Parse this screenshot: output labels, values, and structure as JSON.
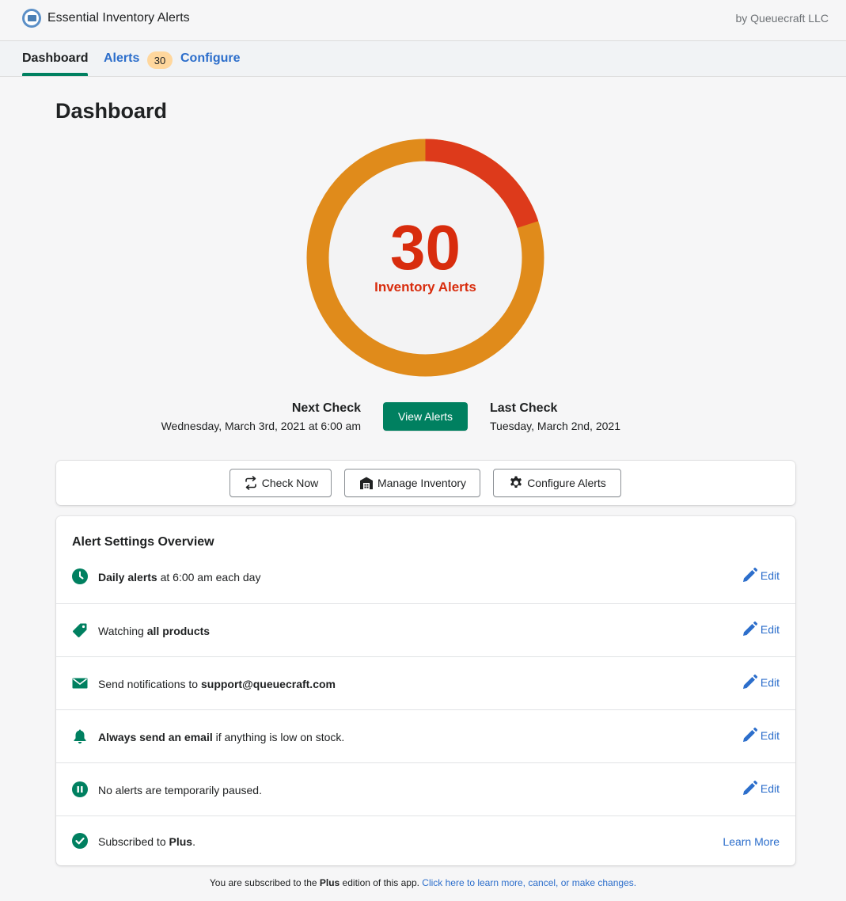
{
  "app": {
    "title": "Essential Inventory Alerts",
    "vendor": "by Queuecraft LLC"
  },
  "tabs": {
    "dashboard": "Dashboard",
    "alerts": "Alerts",
    "alerts_count": "30",
    "configure": "Configure"
  },
  "page": {
    "title": "Dashboard"
  },
  "summary": {
    "count": "30",
    "label": "Inventory Alerts",
    "next_check_heading": "Next Check",
    "next_check_date": "Wednesday, March 3rd, 2021 at 6:00 am",
    "view_alerts_label": "View Alerts",
    "last_check_heading": "Last Check",
    "last_check_date": "Tuesday, March 2nd, 2021",
    "ring_red_fraction": 0.2,
    "ring_colors": {
      "red": "#dd3a1b",
      "orange": "#e08b1b"
    }
  },
  "actions": {
    "check_now": "Check Now",
    "manage_inventory": "Manage Inventory",
    "configure_alerts": "Configure Alerts"
  },
  "settings": {
    "title": "Alert Settings Overview",
    "edit_label": "Edit",
    "learn_more": "Learn More",
    "rows": [
      {
        "icon": "clock-icon",
        "bold": "Daily alerts",
        "rest": " at 6:00 am each day"
      },
      {
        "icon": "tag-icon",
        "prefix": "Watching ",
        "bold": "all products"
      },
      {
        "icon": "envelope-icon",
        "prefix": "Send notifications to ",
        "bold": "support@queuecraft.com"
      },
      {
        "icon": "bell-icon",
        "bold": "Always send an email",
        "rest": " if anything is low on stock."
      },
      {
        "icon": "pause-icon",
        "prefix": "No alerts are temporarily paused."
      },
      {
        "icon": "checkmark-icon",
        "prefix": "Subscribed to ",
        "bold": "Plus",
        "rest": "."
      }
    ]
  },
  "footer": {
    "prefix": "You are subscribed to the ",
    "plan": "Plus",
    "middle": " edition of this app. ",
    "link": "Click here to learn more, cancel, or make changes."
  },
  "colors": {
    "primary_green": "#008060",
    "alert_red": "#d82c0d",
    "link_blue": "#2c6ecb",
    "badge_orange": "#ffd79d"
  }
}
